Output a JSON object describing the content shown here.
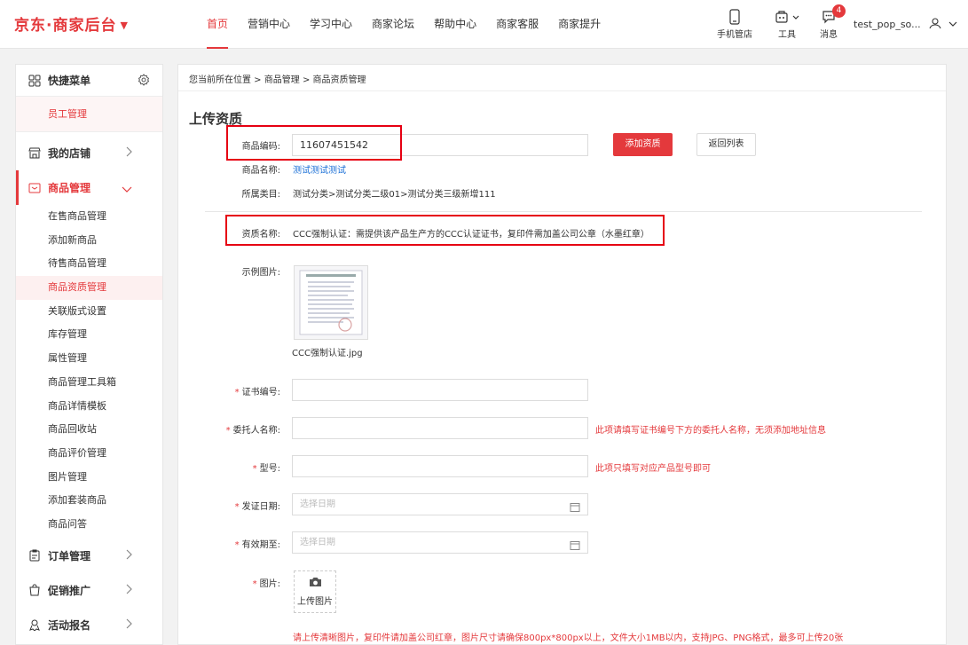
{
  "brand": {
    "logo": "京东·商家后台",
    "caret": "▼",
    "accent": "#e4393c"
  },
  "nav": {
    "items": [
      "首页",
      "营销中心",
      "学习中心",
      "商家论坛",
      "帮助中心",
      "商家客服",
      "商家提升"
    ],
    "active": "首页"
  },
  "tools": {
    "mobile": "手机管店",
    "tools": "工具",
    "messages": "消息",
    "message_count": "4",
    "username": "test_pop_so..."
  },
  "sidebar": {
    "quick_title": "快捷菜单",
    "quick_item": "员工管理",
    "groups": {
      "store": "我的店铺",
      "product": "商品管理",
      "order": "订单管理",
      "promo": "促销推广",
      "event": "活动报名"
    },
    "product_items": [
      "在售商品管理",
      "添加新商品",
      "待售商品管理",
      "商品资质管理",
      "关联版式设置",
      "库存管理",
      "属性管理",
      "商品管理工具箱",
      "商品详情模板",
      "商品回收站",
      "商品评价管理",
      "图片管理",
      "添加套装商品",
      "商品问答"
    ],
    "active_item": "商品资质管理"
  },
  "breadcrumb": {
    "prefix": "您当前所在位置 >",
    "level1": "商品管理",
    "sep": ">",
    "level2": "商品资质管理"
  },
  "page": {
    "title": "上传资质"
  },
  "form": {
    "sku_label": "商品编码:",
    "sku_value": "11607451542",
    "add_button": "添加资质",
    "back_button": "返回列表",
    "name_label": "商品名称:",
    "name_value": "测试测试测试",
    "category_label": "所属类目:",
    "category_value": "测试分类>测试分类二级01>测试分类三级新增111",
    "qual_label": "资质名称:",
    "qual_value": "CCC强制认证：需提供该产品生产方的CCC认证证书，复印件需加盖公司公章（水墨红章）",
    "example_label": "示例图片:",
    "example_file": "CCC强制认证.jpg",
    "required_mark": "*",
    "cert_no_label": "证书编号:",
    "client_label": "委托人名称:",
    "client_hint": "此项请填写证书编号下方的委托人名称，无须添加地址信息",
    "model_label": "型号:",
    "model_hint": "此项只填写对应产品型号即可",
    "issue_date_label": "发证日期:",
    "issue_date_placeholder": "选择日期",
    "expire_label": "有效期至:",
    "expire_placeholder": "选择日期",
    "image_label": "图片:",
    "upload_label": "上传图片",
    "upload_hint": "请上传清晰图片，复印件请加盖公司红章，图片尺寸请确保800px*800px以上，文件大小1MB以内，支持JPG、PNG格式，最多可上传20张"
  }
}
